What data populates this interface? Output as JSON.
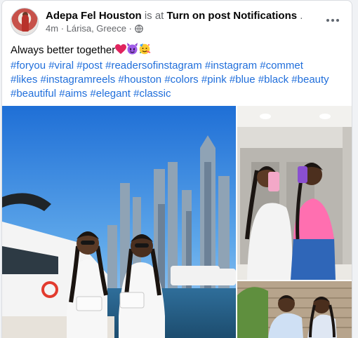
{
  "post": {
    "author": "Adepa Fel Houston",
    "is_at": "is at",
    "place": "Turn on post Notifications",
    "place_suffix": ".",
    "time": "4m",
    "separator": "·",
    "location": "Lárisa, Greece",
    "separator2": "·",
    "caption": "Always better together",
    "hashtags": [
      "#foryou",
      "#viral",
      "#post",
      "#readersofinstagram",
      "#instagram",
      "#commet",
      "#likes",
      "#instagramreels",
      "#houston",
      "#colors",
      "#pink",
      "#blue",
      "#black",
      "#beauty",
      "#beautiful",
      "#aims",
      "#elegant",
      "#classic"
    ]
  },
  "icons": {
    "avatar": "profile-avatar",
    "audience": "globe-icon",
    "menu": "more-horizontal-icon",
    "emojis": [
      "red-heart-emoji",
      "smiling-devil-emoji",
      "partying-face-emoji"
    ]
  },
  "photos": [
    {
      "name": "photo-main",
      "subject": "two women in white dresses holding bags by a yacht with a skyline"
    },
    {
      "name": "photo-mirror-selfie",
      "subject": "two women taking a mirror selfie"
    },
    {
      "name": "photo-third",
      "subject": "two women outdoors by a wooden wall"
    }
  ],
  "colors": {
    "link": "#216fdb",
    "text": "#050505",
    "muted": "#65676b",
    "heart": "#e0245e"
  }
}
